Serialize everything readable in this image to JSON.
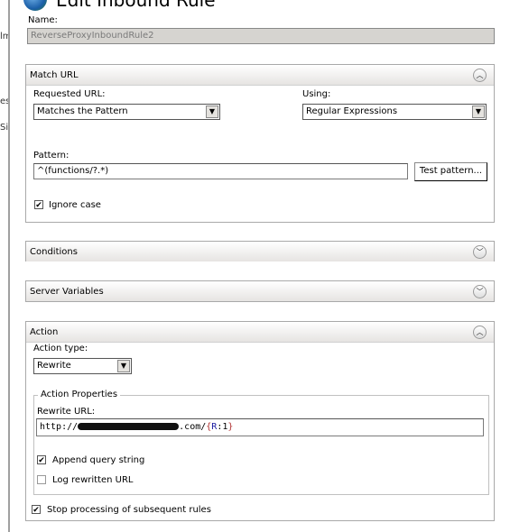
{
  "sidebar": {
    "fragments": [
      "lm",
      "es",
      "Sit"
    ]
  },
  "header": {
    "title": "Edit Inbound Rule",
    "icon": "globe-icon"
  },
  "name": {
    "label": "Name:",
    "value": "ReverseProxyInboundRule2"
  },
  "match_url": {
    "title": "Match URL",
    "expanded": true,
    "requested_url": {
      "label": "Requested URL:",
      "value": "Matches the Pattern"
    },
    "using": {
      "label": "Using:",
      "value": "Regular Expressions"
    },
    "pattern": {
      "label": "Pattern:",
      "value": "^(functions/?.*)"
    },
    "test_button": "Test pattern...",
    "ignore_case": {
      "label": "Ignore case",
      "checked": true
    }
  },
  "conditions": {
    "title": "Conditions",
    "expanded": false
  },
  "server_variables": {
    "title": "Server Variables",
    "expanded": false
  },
  "action": {
    "title": "Action",
    "expanded": true,
    "action_type": {
      "label": "Action type:",
      "value": "Rewrite"
    },
    "properties": {
      "legend": "Action Properties",
      "rewrite_url": {
        "label": "Rewrite URL:",
        "prefix": "http://",
        "suffix": ".com/",
        "brace_open": "{",
        "var": "R",
        "colon": ":",
        "num": "1",
        "brace_close": "}"
      },
      "append_query": {
        "label": "Append query string",
        "checked": true
      },
      "log_rewritten": {
        "label": "Log rewritten URL",
        "checked": false
      }
    },
    "stop_processing": {
      "label": "Stop processing of subsequent rules",
      "checked": true
    }
  },
  "colors": {
    "brace": "#b03030",
    "var": "#1a1aa0"
  }
}
